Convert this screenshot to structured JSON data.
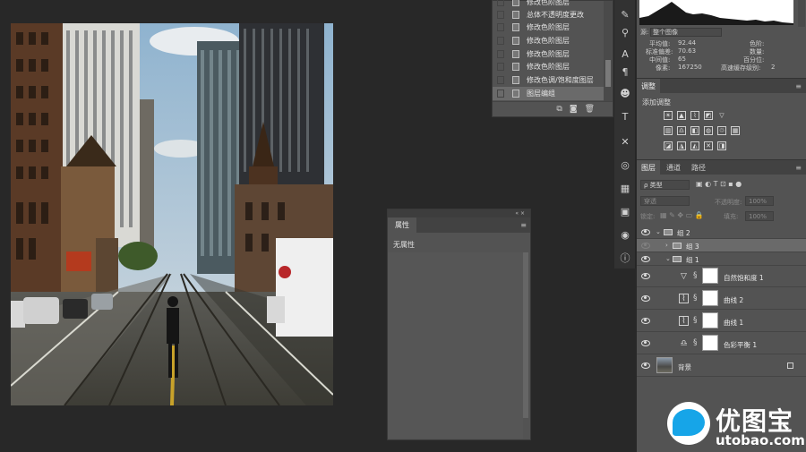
{
  "history": {
    "items": [
      {
        "label": "修改色阶图层"
      },
      {
        "label": "总体不透明度更改"
      },
      {
        "label": "修改色阶图层"
      },
      {
        "label": "修改色阶图层"
      },
      {
        "label": "修改色阶图层"
      },
      {
        "label": "修改色阶图层"
      },
      {
        "label": "修改色调/饱和度图层"
      },
      {
        "label": "图层编组"
      }
    ]
  },
  "properties": {
    "tab": "属性",
    "content": "无属性"
  },
  "histogram": {
    "source_label": "源:",
    "source_value": "整个图像",
    "mean_label": "平均值:",
    "mean": "92.44",
    "std_label": "标准偏差:",
    "std": "70.63",
    "median_label": "中间值:",
    "median": "65",
    "pixels_label": "像素:",
    "pixels": "167250",
    "level_label": "色阶:",
    "count_label": "数量:",
    "percent_label": "百分位:",
    "cache_label": "高速缓存级别:",
    "cache": "2"
  },
  "adjustments": {
    "tab": "调整",
    "add_label": "添加调整"
  },
  "layers_panel": {
    "tabs": [
      "图层",
      "通道",
      "路径"
    ],
    "filter_label": "ρ 类型",
    "blend_mode": "穿透",
    "opacity_label": "不透明度:",
    "opacity": "100%",
    "lock_label": "锁定:",
    "fill_label": "填充:",
    "fill": "100%",
    "layers": [
      {
        "name": "组 2"
      },
      {
        "name": "组 3"
      },
      {
        "name": "组 1"
      },
      {
        "name": "自然饱和度 1"
      },
      {
        "name": "曲线 2"
      },
      {
        "name": "曲线 1"
      },
      {
        "name": "色彩平衡 1"
      },
      {
        "name": "背景"
      }
    ]
  },
  "watermark": {
    "cn": "优图宝",
    "en": "utobao.com"
  }
}
